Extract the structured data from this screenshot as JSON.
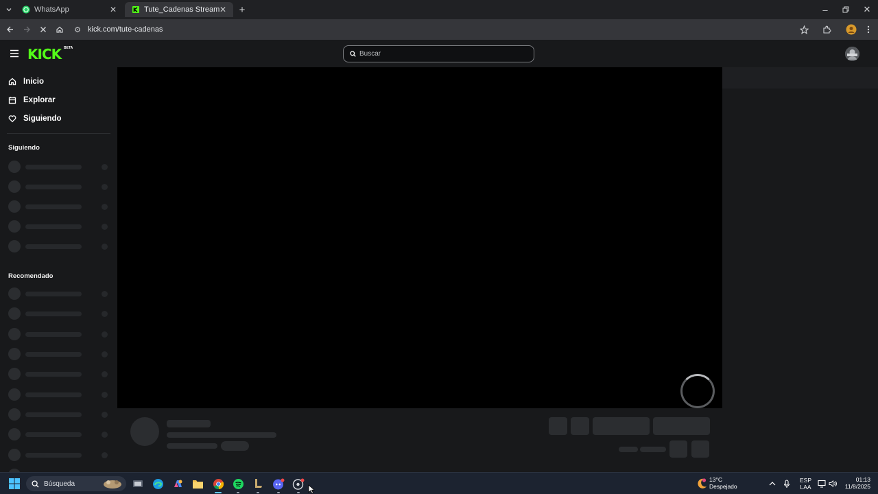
{
  "browser": {
    "tabs": [
      {
        "title": "WhatsApp",
        "active": false
      },
      {
        "title": "Tute_Cadenas Stream - Watch Live",
        "active": true
      }
    ],
    "url": "kick.com/tute-cadenas"
  },
  "kick": {
    "logo": "KICK",
    "logo_badge": "BETA",
    "search_placeholder": "Buscar",
    "accent": "#53fc18"
  },
  "sidebar": {
    "nav": [
      {
        "label": "Inicio",
        "icon": "home-icon"
      },
      {
        "label": "Explorar",
        "icon": "compass-icon"
      },
      {
        "label": "Siguiendo",
        "icon": "heart-icon"
      }
    ],
    "section_following": "Siguiendo",
    "section_recommended": "Recomendado"
  },
  "taskbar": {
    "search_label": "Búsqueda",
    "weather_temp": "13°C",
    "weather_desc": "Despejado",
    "lang_1": "ESP",
    "lang_2": "LAA",
    "time": "01:13",
    "date": "11/8/2025"
  }
}
